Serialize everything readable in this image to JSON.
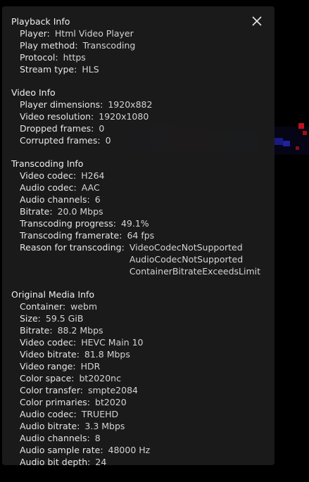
{
  "playback": {
    "title": "Playback Info",
    "rows": [
      {
        "label": "Player:",
        "value": "Html Video Player"
      },
      {
        "label": "Play method:",
        "value": "Transcoding"
      },
      {
        "label": "Protocol:",
        "value": "https"
      },
      {
        "label": "Stream type:",
        "value": "HLS"
      }
    ]
  },
  "video": {
    "title": "Video Info",
    "rows": [
      {
        "label": "Player dimensions:",
        "value": "1920x882"
      },
      {
        "label": "Video resolution:",
        "value": "1920x1080"
      },
      {
        "label": "Dropped frames:",
        "value": "0"
      },
      {
        "label": "Corrupted frames:",
        "value": "0"
      }
    ]
  },
  "transcoding": {
    "title": "Transcoding Info",
    "rows": [
      {
        "label": "Video codec:",
        "value": "H264"
      },
      {
        "label": "Audio codec:",
        "value": "AAC"
      },
      {
        "label": "Audio channels:",
        "value": "6"
      },
      {
        "label": "Bitrate:",
        "value": "20.0 Mbps"
      },
      {
        "label": "Transcoding progress:",
        "value": "49.1%"
      },
      {
        "label": "Transcoding framerate:",
        "value": "64 fps"
      }
    ],
    "reason_label": "Reason for transcoding:",
    "reasons": [
      "VideoCodecNotSupported",
      "AudioCodecNotSupported",
      "ContainerBitrateExceedsLimit"
    ]
  },
  "original": {
    "title": "Original Media Info",
    "rows": [
      {
        "label": "Container:",
        "value": "webm"
      },
      {
        "label": "Size:",
        "value": "59.5 GiB"
      },
      {
        "label": "Bitrate:",
        "value": "88.2 Mbps"
      },
      {
        "label": "Video codec:",
        "value": "HEVC Main 10"
      },
      {
        "label": "Video bitrate:",
        "value": "81.8 Mbps"
      },
      {
        "label": "Video range:",
        "value": "HDR"
      },
      {
        "label": "Color space:",
        "value": "bt2020nc"
      },
      {
        "label": "Color transfer:",
        "value": "smpte2084"
      },
      {
        "label": "Color primaries:",
        "value": "bt2020"
      },
      {
        "label": "Audio codec:",
        "value": "TRUEHD"
      },
      {
        "label": "Audio bitrate:",
        "value": "3.3 Mbps"
      },
      {
        "label": "Audio channels:",
        "value": "8"
      },
      {
        "label": "Audio sample rate:",
        "value": "48000 Hz"
      },
      {
        "label": "Audio bit depth:",
        "value": "24"
      }
    ]
  },
  "icons": {
    "close": "close-icon"
  },
  "colors": {
    "panel_bg": "#1c1c1c",
    "text": "#e6e6e6",
    "page_bg": "#000000"
  }
}
